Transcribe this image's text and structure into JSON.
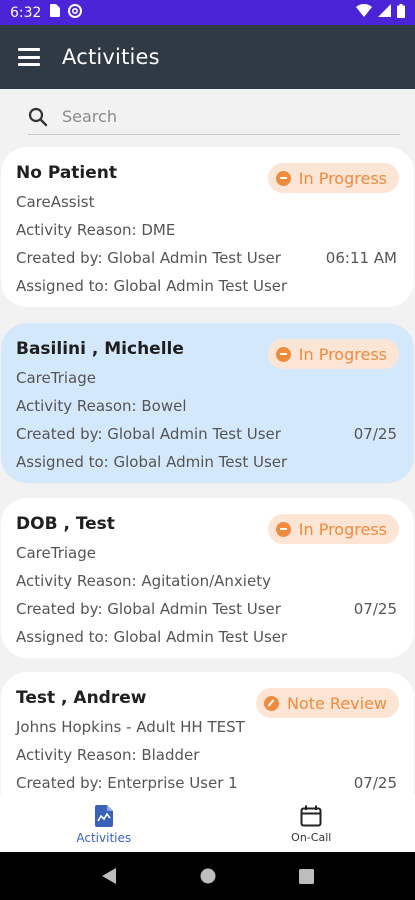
{
  "status_bar": {
    "time": "6:32"
  },
  "app_bar": {
    "title": "Activities"
  },
  "search": {
    "placeholder": "Search"
  },
  "activities": [
    {
      "name": "No Patient",
      "program": "CareAssist",
      "reason": "Activity Reason: DME",
      "created_by": "Created by: Global Admin Test User",
      "date": "06:11 AM",
      "assigned_to": "Assigned to: Global Admin Test User",
      "status": "In Progress",
      "selected": false
    },
    {
      "name": "Basilini , Michelle",
      "program": "CareTriage",
      "reason": "Activity Reason: Bowel",
      "created_by": "Created by: Global Admin Test User",
      "date": "07/25",
      "assigned_to": "Assigned to: Global Admin Test User",
      "status": "In Progress",
      "selected": true
    },
    {
      "name": "DOB , Test",
      "program": "CareTriage",
      "reason": "Activity Reason: Agitation/Anxiety",
      "created_by": "Created by: Global Admin Test User",
      "date": "07/25",
      "assigned_to": "Assigned to: Global Admin Test User",
      "status": "In Progress",
      "selected": false
    },
    {
      "name": "Test , Andrew",
      "program": "Johns Hopkins - Adult HH TEST",
      "reason": "Activity Reason: Bladder",
      "created_by": "Created by: Enterprise User 1",
      "date": "07/25",
      "assigned_to": "",
      "status": "Note Review",
      "selected": false
    }
  ],
  "bottom_nav": {
    "activities_label": "Activities",
    "oncall_label": "On-Call"
  },
  "colors": {
    "status_bar": "#4a24d6",
    "app_bar": "#2f3a45",
    "selected_card": "#d4e8fb",
    "badge_text": "#f08a3c",
    "badge_bg": "#fde5d6",
    "nav_active": "#3a63b8"
  }
}
